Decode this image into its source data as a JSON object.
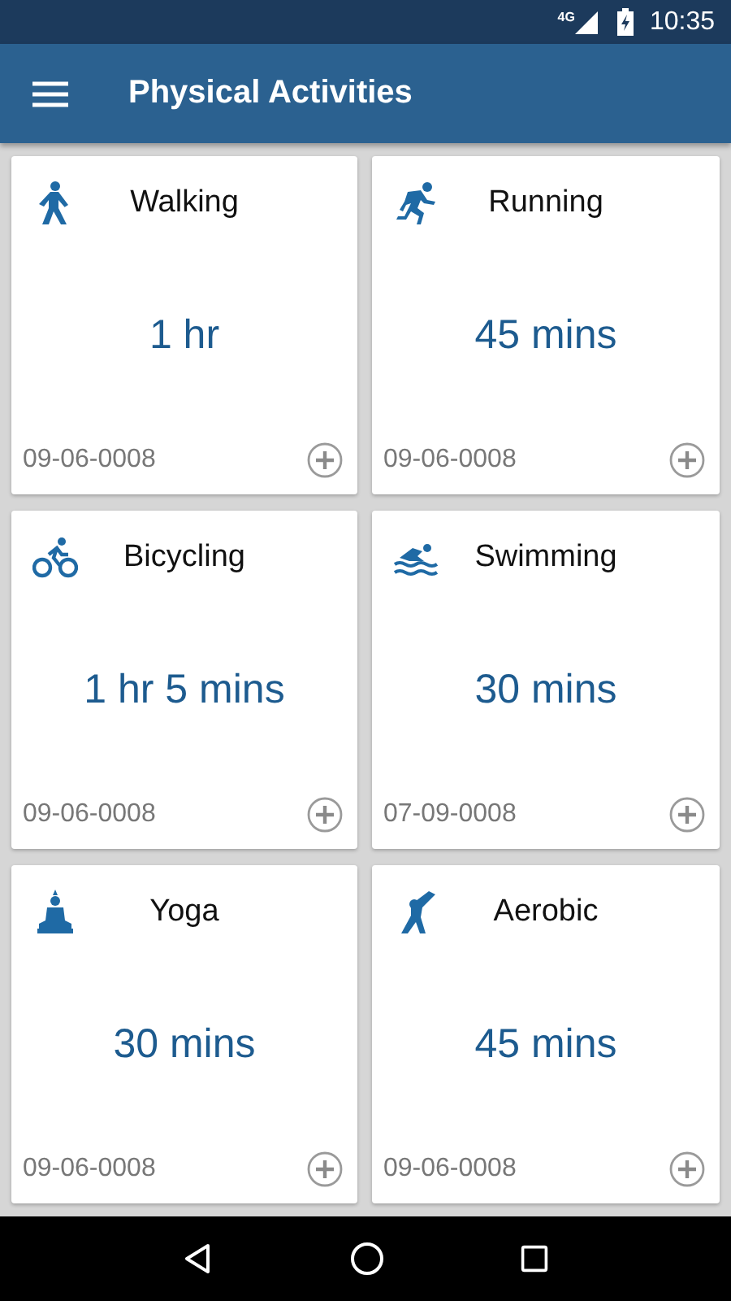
{
  "status_bar": {
    "network": "4G",
    "time": "10:35"
  },
  "app_bar": {
    "title": "Physical Activities"
  },
  "activities": [
    {
      "kind": "walking",
      "name": "Walking",
      "duration": "1 hr",
      "date": "09-06-0008"
    },
    {
      "kind": "running",
      "name": "Running",
      "duration": "45 mins",
      "date": "09-06-0008"
    },
    {
      "kind": "cycling",
      "name": "Bicycling",
      "duration": "1 hr 5 mins",
      "date": "09-06-0008"
    },
    {
      "kind": "swimming",
      "name": "Swimming",
      "duration": "30 mins",
      "date": "07-09-0008"
    },
    {
      "kind": "yoga",
      "name": "Yoga",
      "duration": "30 mins",
      "date": "09-06-0008"
    },
    {
      "kind": "aerobic",
      "name": "Aerobic",
      "duration": "45 mins",
      "date": "09-06-0008"
    }
  ]
}
